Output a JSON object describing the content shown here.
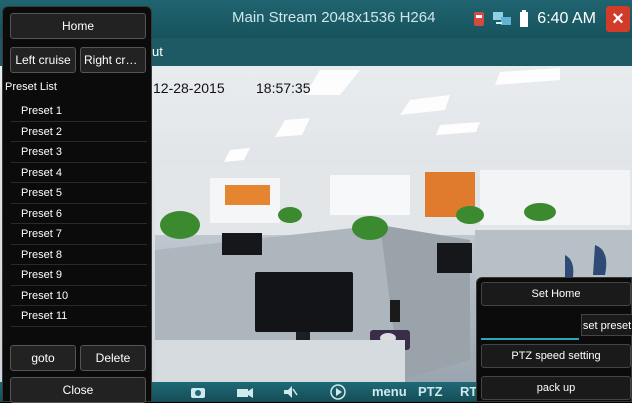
{
  "header": {
    "stream_title": "Main Stream 2048x1536 H264",
    "time": "6:40 AM",
    "icons": [
      "recording-icon",
      "network-icon",
      "battery-icon",
      "close-icon"
    ]
  },
  "tab_fragment": "ut",
  "overlay": {
    "date": "12-28-2015",
    "time": "18:57:35"
  },
  "left_panel": {
    "home": "Home",
    "left_cruise": "Left cruise",
    "right_cruise": "Right crui...",
    "preset_list_title": "Preset List",
    "presets": [
      "Preset 1",
      "Preset 2",
      "Preset 3",
      "Preset 4",
      "Preset 5",
      "Preset 6",
      "Preset 7",
      "Preset 8",
      "Preset 9",
      "Preset 10",
      "Preset 11"
    ],
    "goto": "goto",
    "delete": "Delete",
    "close": "Close"
  },
  "right_panel": {
    "set_home": "Set Home",
    "preset_input_value": "",
    "set_preset": "set preset",
    "ptz_speed": "PTZ speed setting",
    "pack_up": "pack up"
  },
  "toolbar": {
    "menu": "menu",
    "ptz": "PTZ",
    "rt": "RT"
  },
  "colors": {
    "bar": "#17535d",
    "accent": "#2aa6b6",
    "close": "#d23a2a"
  }
}
